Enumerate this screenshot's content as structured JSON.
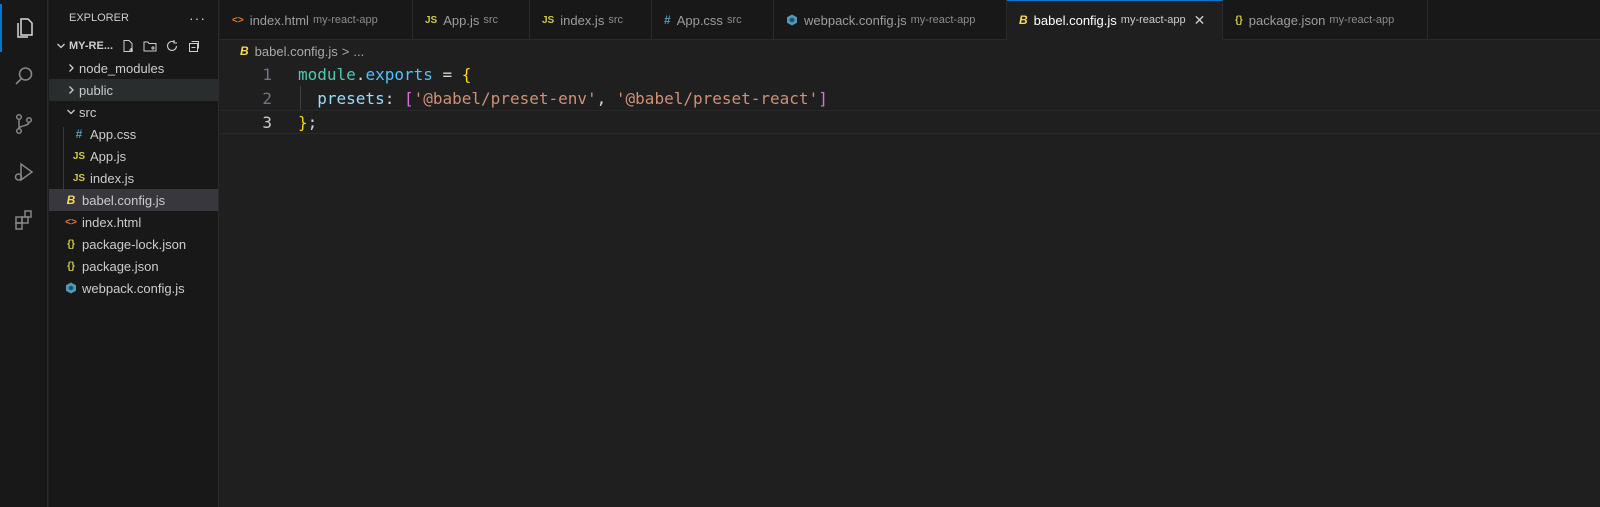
{
  "explorer": {
    "title": "EXPLORER",
    "more": "···",
    "folder_name": "MY-RE...",
    "tree": [
      {
        "label": "node_modules",
        "type": "folder-collapsed"
      },
      {
        "label": "public",
        "type": "folder-collapsed"
      },
      {
        "label": "src",
        "type": "folder-expanded"
      },
      {
        "label": "App.css",
        "type": "css"
      },
      {
        "label": "App.js",
        "type": "js"
      },
      {
        "label": "index.js",
        "type": "js"
      },
      {
        "label": "babel.config.js",
        "type": "babel"
      },
      {
        "label": "index.html",
        "type": "html"
      },
      {
        "label": "package-lock.json",
        "type": "json"
      },
      {
        "label": "package.json",
        "type": "json"
      },
      {
        "label": "webpack.config.js",
        "type": "webpack"
      }
    ]
  },
  "tabs": [
    {
      "label": "index.html",
      "desc": "my-react-app",
      "icon": "html-icon",
      "icon_text": "<>"
    },
    {
      "label": "App.js",
      "desc": "src",
      "icon": "js-icon",
      "icon_text": "JS"
    },
    {
      "label": "index.js",
      "desc": "src",
      "icon": "js-icon",
      "icon_text": "JS"
    },
    {
      "label": "App.css",
      "desc": "src",
      "icon": "css-icon",
      "icon_text": "#"
    },
    {
      "label": "webpack.config.js",
      "desc": "my-react-app",
      "icon": "webpack-icon",
      "icon_text": ""
    },
    {
      "label": "babel.config.js",
      "desc": "my-react-app",
      "icon": "babel-icon",
      "icon_text": "B",
      "active": true
    },
    {
      "label": "package.json",
      "desc": "my-react-app",
      "icon": "json-icon",
      "icon_text": "{}"
    }
  ],
  "breadcrumb": {
    "file": "babel.config.js",
    "sep": ">",
    "rest": "..."
  },
  "editor": {
    "line_numbers": [
      "1",
      "2",
      "3"
    ],
    "line1": {
      "module": "module",
      "dot": ".",
      "exports": "exports",
      "eq": " = ",
      "open": "{"
    },
    "line2": {
      "indent": "  ",
      "key": "presets",
      "colon": ": ",
      "lb": "[",
      "s1": "'@babel/preset-env'",
      "comma": ", ",
      "s2": "'@babel/preset-react'",
      "rb": "]"
    },
    "line3": {
      "close": "}",
      "semi": ";"
    }
  },
  "colors": {
    "accent": "#0078d4",
    "js": "#cbcb41",
    "css": "#519aba",
    "html": "#e37933",
    "json": "#cbcb41",
    "webpack": "#519aba",
    "babel": "#f5da55"
  }
}
